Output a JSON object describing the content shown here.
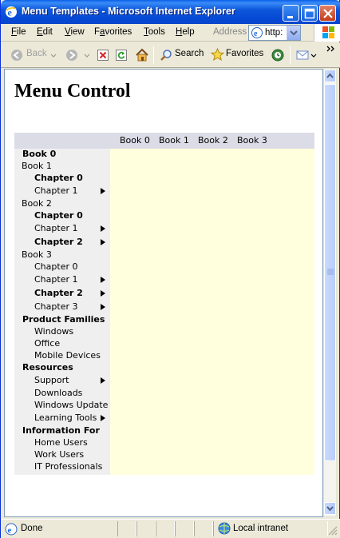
{
  "window": {
    "title": "Menu Templates - Microsoft Internet Explorer"
  },
  "menubar": {
    "items": [
      {
        "hotkey": "F",
        "rest": "ile"
      },
      {
        "hotkey": "E",
        "rest": "dit"
      },
      {
        "hotkey": "V",
        "rest": "iew"
      },
      {
        "pre": "F",
        "hotkey": "a",
        "rest": "vorites"
      },
      {
        "hotkey": "T",
        "rest": "ools"
      },
      {
        "hotkey": "H",
        "rest": "elp"
      }
    ],
    "address_label": "Address",
    "address_value": "http:"
  },
  "toolbar": {
    "back": "Back",
    "search": "Search",
    "favorites": "Favorites"
  },
  "page": {
    "title": "Menu Control",
    "header_links": [
      "Book 0",
      "Book 1",
      "Book 2",
      "Book 3"
    ],
    "nav": [
      {
        "label": "Book 0",
        "level": 0,
        "bold": true,
        "arrow": false
      },
      {
        "label": "Book 1",
        "level": 0,
        "bold": false,
        "arrow": false
      },
      {
        "label": "Chapter 0",
        "level": 1,
        "bold": true,
        "arrow": false
      },
      {
        "label": "Chapter 1",
        "level": 1,
        "bold": false,
        "arrow": true
      },
      {
        "label": "Book 2",
        "level": 0,
        "bold": false,
        "arrow": false
      },
      {
        "label": "Chapter 0",
        "level": 1,
        "bold": true,
        "arrow": false
      },
      {
        "label": "Chapter 1",
        "level": 1,
        "bold": false,
        "arrow": true
      },
      {
        "label": "Chapter 2",
        "level": 1,
        "bold": true,
        "arrow": true
      },
      {
        "label": "Book 3",
        "level": 0,
        "bold": false,
        "arrow": false
      },
      {
        "label": "Chapter 0",
        "level": 1,
        "bold": false,
        "arrow": false
      },
      {
        "label": "Chapter 1",
        "level": 1,
        "bold": false,
        "arrow": true
      },
      {
        "label": "Chapter 2",
        "level": 1,
        "bold": true,
        "arrow": true
      },
      {
        "label": "Chapter 3",
        "level": 1,
        "bold": false,
        "arrow": true
      },
      {
        "label": "Product Families",
        "level": 0,
        "bold": true,
        "arrow": false
      },
      {
        "label": "Windows",
        "level": 1,
        "bold": false,
        "arrow": false
      },
      {
        "label": "Office",
        "level": 1,
        "bold": false,
        "arrow": false
      },
      {
        "label": "Mobile Devices",
        "level": 1,
        "bold": false,
        "arrow": false
      },
      {
        "label": "Resources",
        "level": 0,
        "bold": true,
        "arrow": false
      },
      {
        "label": "Support",
        "level": 1,
        "bold": false,
        "arrow": true
      },
      {
        "label": "Downloads",
        "level": 1,
        "bold": false,
        "arrow": false
      },
      {
        "label": "Windows Update",
        "level": 1,
        "bold": false,
        "arrow": false
      },
      {
        "label": "Learning Tools",
        "level": 1,
        "bold": false,
        "arrow": true
      },
      {
        "label": "Information For",
        "level": 0,
        "bold": true,
        "arrow": false
      },
      {
        "label": "Home Users",
        "level": 1,
        "bold": false,
        "arrow": false
      },
      {
        "label": "Work Users",
        "level": 1,
        "bold": false,
        "arrow": false
      },
      {
        "label": "IT Professionals",
        "level": 1,
        "bold": false,
        "arrow": false
      }
    ]
  },
  "statusbar": {
    "status": "Done",
    "zone": "Local intranet"
  },
  "colors": {
    "nav_bg": "#EFEFEF",
    "header_bg": "#DCDCE6",
    "content_bg": "#FFFFDD"
  }
}
